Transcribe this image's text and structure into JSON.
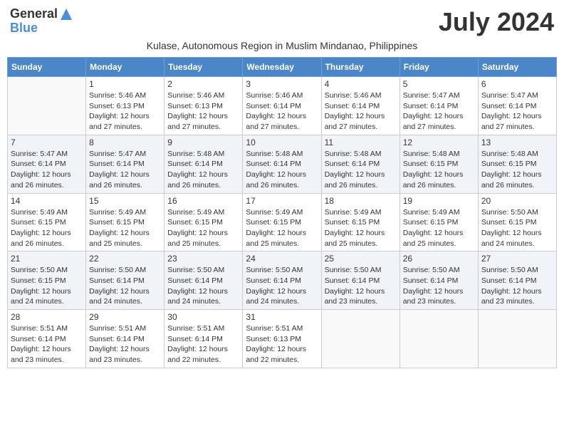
{
  "header": {
    "logo_general": "General",
    "logo_blue": "Blue",
    "month_title": "July 2024",
    "subtitle": "Kulase, Autonomous Region in Muslim Mindanao, Philippines"
  },
  "weekdays": [
    "Sunday",
    "Monday",
    "Tuesday",
    "Wednesday",
    "Thursday",
    "Friday",
    "Saturday"
  ],
  "weeks": [
    [
      {
        "day": "",
        "info": ""
      },
      {
        "day": "1",
        "info": "Sunrise: 5:46 AM\nSunset: 6:13 PM\nDaylight: 12 hours\nand 27 minutes."
      },
      {
        "day": "2",
        "info": "Sunrise: 5:46 AM\nSunset: 6:13 PM\nDaylight: 12 hours\nand 27 minutes."
      },
      {
        "day": "3",
        "info": "Sunrise: 5:46 AM\nSunset: 6:14 PM\nDaylight: 12 hours\nand 27 minutes."
      },
      {
        "day": "4",
        "info": "Sunrise: 5:46 AM\nSunset: 6:14 PM\nDaylight: 12 hours\nand 27 minutes."
      },
      {
        "day": "5",
        "info": "Sunrise: 5:47 AM\nSunset: 6:14 PM\nDaylight: 12 hours\nand 27 minutes."
      },
      {
        "day": "6",
        "info": "Sunrise: 5:47 AM\nSunset: 6:14 PM\nDaylight: 12 hours\nand 27 minutes."
      }
    ],
    [
      {
        "day": "7",
        "info": ""
      },
      {
        "day": "8",
        "info": "Sunrise: 5:47 AM\nSunset: 6:14 PM\nDaylight: 12 hours\nand 26 minutes."
      },
      {
        "day": "9",
        "info": "Sunrise: 5:48 AM\nSunset: 6:14 PM\nDaylight: 12 hours\nand 26 minutes."
      },
      {
        "day": "10",
        "info": "Sunrise: 5:48 AM\nSunset: 6:14 PM\nDaylight: 12 hours\nand 26 minutes."
      },
      {
        "day": "11",
        "info": "Sunrise: 5:48 AM\nSunset: 6:14 PM\nDaylight: 12 hours\nand 26 minutes."
      },
      {
        "day": "12",
        "info": "Sunrise: 5:48 AM\nSunset: 6:15 PM\nDaylight: 12 hours\nand 26 minutes."
      },
      {
        "day": "13",
        "info": "Sunrise: 5:48 AM\nSunset: 6:15 PM\nDaylight: 12 hours\nand 26 minutes."
      }
    ],
    [
      {
        "day": "14",
        "info": ""
      },
      {
        "day": "15",
        "info": "Sunrise: 5:49 AM\nSunset: 6:15 PM\nDaylight: 12 hours\nand 25 minutes."
      },
      {
        "day": "16",
        "info": "Sunrise: 5:49 AM\nSunset: 6:15 PM\nDaylight: 12 hours\nand 25 minutes."
      },
      {
        "day": "17",
        "info": "Sunrise: 5:49 AM\nSunset: 6:15 PM\nDaylight: 12 hours\nand 25 minutes."
      },
      {
        "day": "18",
        "info": "Sunrise: 5:49 AM\nSunset: 6:15 PM\nDaylight: 12 hours\nand 25 minutes."
      },
      {
        "day": "19",
        "info": "Sunrise: 5:49 AM\nSunset: 6:15 PM\nDaylight: 12 hours\nand 25 minutes."
      },
      {
        "day": "20",
        "info": "Sunrise: 5:50 AM\nSunset: 6:15 PM\nDaylight: 12 hours\nand 24 minutes."
      }
    ],
    [
      {
        "day": "21",
        "info": ""
      },
      {
        "day": "22",
        "info": "Sunrise: 5:50 AM\nSunset: 6:14 PM\nDaylight: 12 hours\nand 24 minutes."
      },
      {
        "day": "23",
        "info": "Sunrise: 5:50 AM\nSunset: 6:14 PM\nDaylight: 12 hours\nand 24 minutes."
      },
      {
        "day": "24",
        "info": "Sunrise: 5:50 AM\nSunset: 6:14 PM\nDaylight: 12 hours\nand 24 minutes."
      },
      {
        "day": "25",
        "info": "Sunrise: 5:50 AM\nSunset: 6:14 PM\nDaylight: 12 hours\nand 23 minutes."
      },
      {
        "day": "26",
        "info": "Sunrise: 5:50 AM\nSunset: 6:14 PM\nDaylight: 12 hours\nand 23 minutes."
      },
      {
        "day": "27",
        "info": "Sunrise: 5:50 AM\nSunset: 6:14 PM\nDaylight: 12 hours\nand 23 minutes."
      }
    ],
    [
      {
        "day": "28",
        "info": "Sunrise: 5:51 AM\nSunset: 6:14 PM\nDaylight: 12 hours\nand 23 minutes."
      },
      {
        "day": "29",
        "info": "Sunrise: 5:51 AM\nSunset: 6:14 PM\nDaylight: 12 hours\nand 23 minutes."
      },
      {
        "day": "30",
        "info": "Sunrise: 5:51 AM\nSunset: 6:14 PM\nDaylight: 12 hours\nand 22 minutes."
      },
      {
        "day": "31",
        "info": "Sunrise: 5:51 AM\nSunset: 6:13 PM\nDaylight: 12 hours\nand 22 minutes."
      },
      {
        "day": "",
        "info": ""
      },
      {
        "day": "",
        "info": ""
      },
      {
        "day": "",
        "info": ""
      }
    ]
  ],
  "week7_sun": "Sunrise: 5:47 AM\nSunset: 6:14 PM\nDaylight: 12 hours\nand 26 minutes.",
  "week14_sun": "Sunrise: 5:49 AM\nSunset: 6:15 PM\nDaylight: 12 hours\nand 26 minutes.",
  "week21_sun": "Sunrise: 5:50 AM\nSunset: 6:15 PM\nDaylight: 12 hours\nand 24 minutes."
}
